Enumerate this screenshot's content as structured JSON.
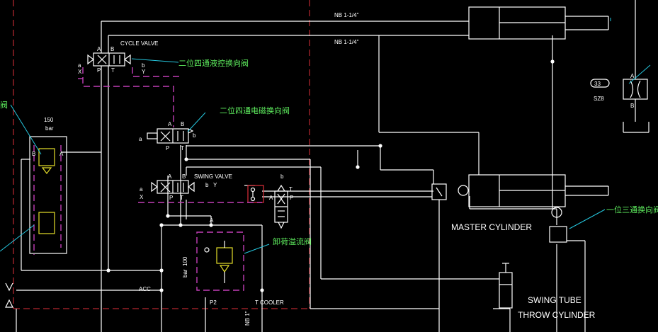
{
  "labels": {
    "nb_top": "NB 1-1/4\"",
    "nb_second": "NB 1-1/4\"",
    "nb_bottom": "NB 1\"",
    "cycle_valve": "CYCLE VALVE",
    "swing_valve": "SWING VALVE",
    "master_cylinder": "MASTER CYLINDER",
    "swing_tube_1": "SWING TUBE",
    "swing_tube_2": "THROW CYLINDER",
    "acc": "ACC",
    "p2": "P2",
    "cooler": "T  COOLER",
    "pressure_150": "150",
    "pressure_150_unit": "bar",
    "pressure_100": "100",
    "pressure_100_unit": "bar",
    "gauge_number": "33",
    "gauge_sub": "SZ8",
    "port_a": "A",
    "port_b": "B",
    "port_p": "P",
    "port_t": "T",
    "port_x": "X",
    "port_y": "Y",
    "port_a_lower": "a",
    "port_b_lower": "b"
  },
  "callouts": {
    "hydraulic_4_2_valve": "二位四通液控换向阀",
    "solenoid_4_2_valve": "二位四通电磁换向阀",
    "unloading_relief_valve": "卸荷溢流阀",
    "three_way_2_valve": "一位三通换向阀",
    "left_edge_fragment": "阀"
  },
  "colors": {
    "background": "#000000",
    "line": "#ffffff",
    "border_dashed": "#e0303a",
    "pilot_dashed": "#c33fb8",
    "leader": "#25c8e0",
    "callout_text": "#5ff05f",
    "component": "#e6e02a"
  }
}
